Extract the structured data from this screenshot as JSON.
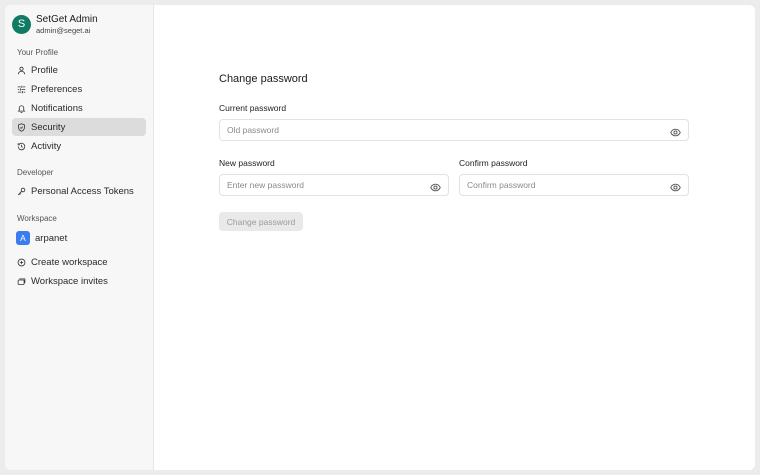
{
  "user": {
    "initial": "S",
    "name": "SetGet Admin",
    "email": "admin@seget.ai"
  },
  "sidebar": {
    "profile_section": {
      "label": "Your Profile",
      "items": [
        {
          "label": "Profile",
          "icon": "user-icon"
        },
        {
          "label": "Preferences",
          "icon": "sliders-icon"
        },
        {
          "label": "Notifications",
          "icon": "bell-icon"
        },
        {
          "label": "Security",
          "icon": "shield-icon",
          "active": true
        },
        {
          "label": "Activity",
          "icon": "history-icon"
        }
      ]
    },
    "developer_section": {
      "label": "Developer",
      "items": [
        {
          "label": "Personal Access Tokens",
          "icon": "key-icon"
        }
      ]
    },
    "workspace_section": {
      "label": "Workspace",
      "workspaces": [
        {
          "initial": "A",
          "name": "arpanet",
          "color": "#3b7cf0"
        }
      ],
      "items": [
        {
          "label": "Create workspace",
          "icon": "plus-circle-icon"
        },
        {
          "label": "Workspace invites",
          "icon": "stack-icon"
        }
      ]
    }
  },
  "main": {
    "title": "Change password",
    "current_password": {
      "label": "Current password",
      "placeholder": "Old password",
      "value": ""
    },
    "new_password": {
      "label": "New password",
      "placeholder": "Enter new password",
      "value": ""
    },
    "confirm_password": {
      "label": "Confirm password",
      "placeholder": "Confirm password",
      "value": ""
    },
    "submit_label": "Change password"
  },
  "colors": {
    "avatar": "#117a64",
    "workspace_badge": "#3b7cf0",
    "active_nav_bg": "#dcdcdc",
    "disabled_button_bg": "#e9e9e9"
  }
}
